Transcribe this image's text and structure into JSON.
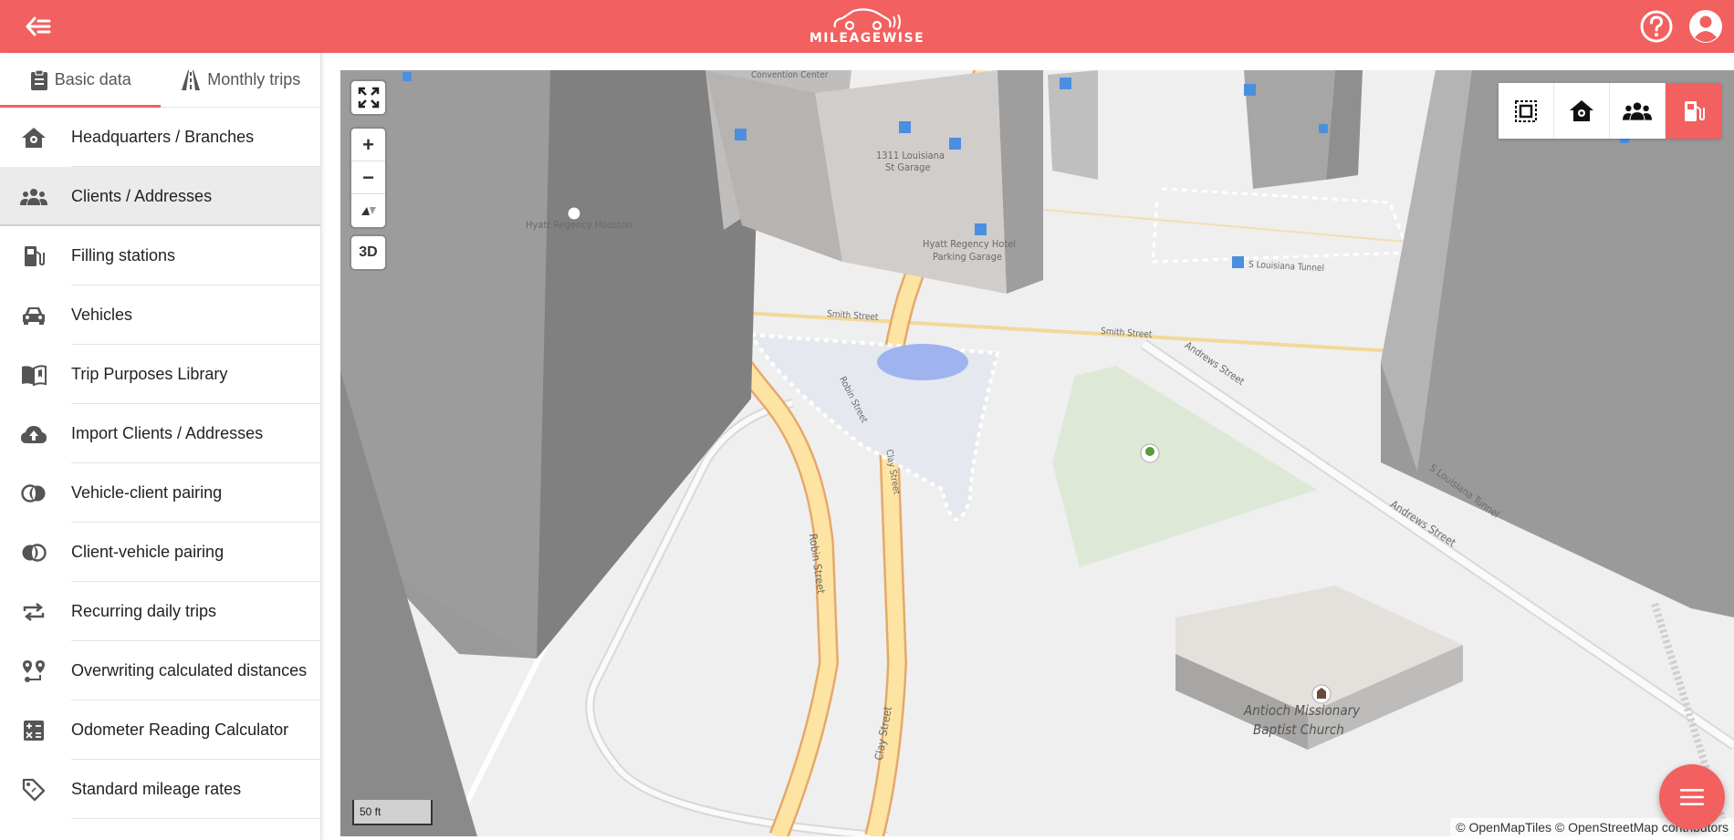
{
  "app": {
    "brand": "MILEAGEWISE",
    "accent_color": "#f2605f"
  },
  "header": {
    "back_icon": "arrow-left-icon",
    "help_icon": "help-circle-icon",
    "account_icon": "account-circle-icon"
  },
  "tabs": [
    {
      "label": "Basic data",
      "icon": "clipboard-icon",
      "active": true
    },
    {
      "label": "Monthly trips",
      "icon": "road-icon",
      "active": false
    }
  ],
  "menu": [
    {
      "label": "Headquarters / Branches",
      "icon": "home-gear-icon"
    },
    {
      "label": "Clients / Addresses",
      "icon": "people-icon",
      "selected": true
    },
    {
      "label": "Filling stations",
      "icon": "fuel-icon"
    },
    {
      "label": "Vehicles",
      "icon": "car-icon"
    },
    {
      "label": "Trip Purposes Library",
      "icon": "book-icon"
    },
    {
      "label": "Import Clients / Addresses",
      "icon": "cloud-upload-icon"
    },
    {
      "label": "Vehicle-client pairing",
      "icon": "pairing-icon"
    },
    {
      "label": "Client-vehicle pairing",
      "icon": "pairing-icon"
    },
    {
      "label": "Recurring daily trips",
      "icon": "repeat-icon"
    },
    {
      "label": "Overwriting calculated distances",
      "icon": "route-icon"
    },
    {
      "label": "Odometer Reading Calculator",
      "icon": "calculator-icon"
    },
    {
      "label": "Standard mileage rates",
      "icon": "tag-icon"
    }
  ],
  "map": {
    "controls": {
      "zoom_in": "+",
      "zoom_out": "−",
      "three_d": "3D"
    },
    "layers": [
      {
        "icon": "select-area-icon",
        "active": false
      },
      {
        "icon": "home-icon",
        "active": false
      },
      {
        "icon": "people-icon",
        "active": false
      },
      {
        "icon": "fuel-icon",
        "active": true
      }
    ],
    "scale": "50 ft",
    "attribution": "© OpenMapTiles © OpenStreetMap contributors",
    "labels": {
      "convention_center": "Convention Center",
      "hyatt_regency": "Hyatt Regency Houston",
      "louisiana_garage_1": "1311 Louisiana",
      "louisiana_garage_2": "St Garage",
      "hyatt_parking_1": "Hyatt Regency Hotel",
      "hyatt_parking_2": "Parking Garage",
      "smith_street_1": "Smith Street",
      "smith_street_2": "Smith Street",
      "robin_street_1": "Robin Street",
      "robin_street_2": "Robin Street",
      "clay_street_1": "Clay Street",
      "clay_street_2": "Clay Street",
      "andrews_street_1": "Andrews Street",
      "andrews_street_2": "Andrews Street",
      "louisiana_tunnel_1": "S Louisiana Tunnel",
      "louisiana_tunnel_2": "S Louisiana Tunnel",
      "church_1": "Antioch Missionary",
      "church_2": "Baptist Church"
    }
  },
  "fab_icon": "menu-icon"
}
